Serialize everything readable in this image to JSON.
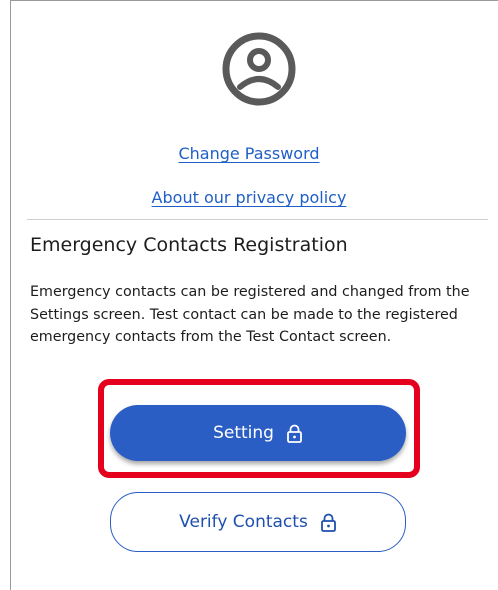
{
  "profile": {
    "avatar_icon": "user-circle-icon"
  },
  "links": {
    "change_password": "Change Password",
    "privacy_policy": "About our privacy policy"
  },
  "emergency": {
    "title": "Emergency Contacts Registration",
    "description": "Emergency contacts can be registered and changed from the Settings screen. Test contact can be made to the registered emergency contacts from the Test Contact screen."
  },
  "buttons": {
    "setting_label": "Setting",
    "setting_icon": "lock-icon",
    "verify_label": "Verify Contacts",
    "verify_icon": "lock-icon"
  },
  "colors": {
    "accent": "#2b5ec4",
    "link": "#1f5fc8",
    "highlight": "#e5001d"
  }
}
